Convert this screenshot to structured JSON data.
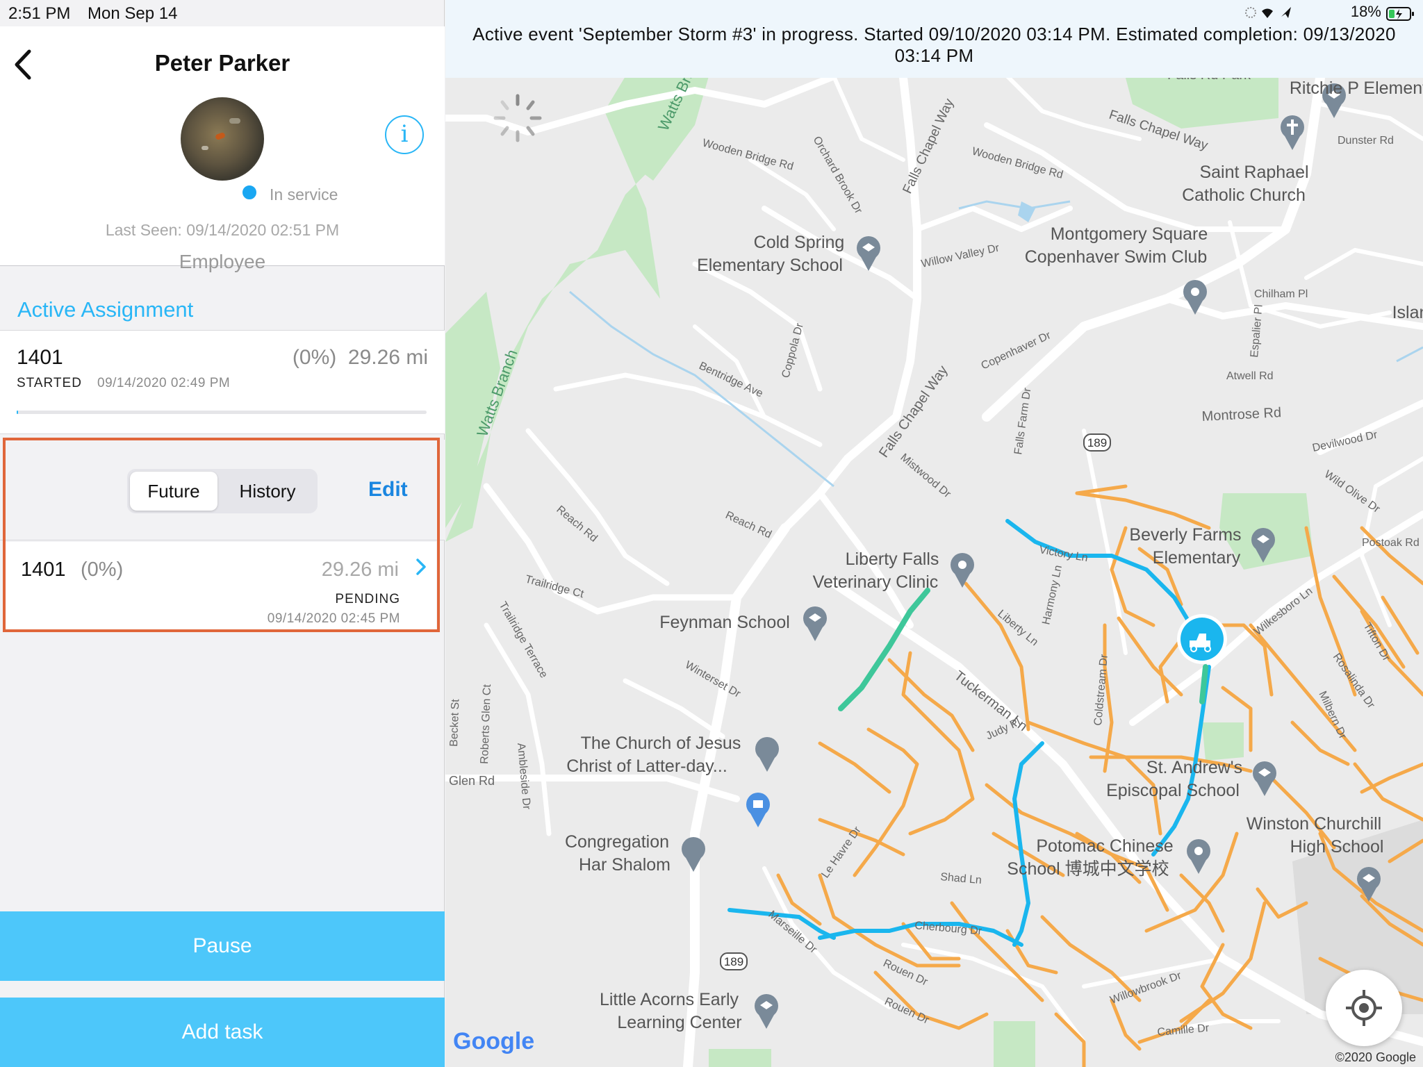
{
  "statusbar": {
    "time": "2:51 PM",
    "date": "Mon Sep 14",
    "battery": "18%"
  },
  "profile": {
    "name": "Peter  Parker",
    "status": "In service",
    "last_seen": "Last Seen: 09/14/2020 02:51 PM",
    "role": "Employee",
    "info_icon": "i"
  },
  "active_assignment": {
    "title": "Active Assignment",
    "id": "1401",
    "percent": "(0%)",
    "distance": "29.26 mi",
    "state": "STARTED",
    "time": "09/14/2020 02:49 PM",
    "progress_fraction": 0.004
  },
  "tasks": {
    "tabs": [
      "Future",
      "History"
    ],
    "active_tab": "Future",
    "edit_label": "Edit",
    "item": {
      "id": "1401",
      "percent": "(0%)",
      "distance": "29.26 mi",
      "state": "PENDING",
      "time": "09/14/2020 02:45 PM"
    }
  },
  "buttons": {
    "pause": "Pause",
    "add_task": "Add task"
  },
  "banner": {
    "text": "Active event 'September Storm #3' in progress. Started 09/10/2020 03:14 PM. Estimated completion: 09/13/2020 03:14 PM"
  },
  "map": {
    "copyright": "©2020 Google",
    "logo": "Google",
    "places": {
      "ritchie": "Ritchie P Element",
      "saint_raphael_1": "Saint Raphael",
      "saint_raphael_2": "Catholic Church",
      "cold_spring_1": "Cold Spring",
      "cold_spring_2": "Elementary School",
      "montgomery_1": "Montgomery Square",
      "montgomery_2": "Copenhaver Swim Club",
      "beverly_1": "Beverly Farms",
      "beverly_2": "Elementary",
      "liberty_1": "Liberty Falls",
      "liberty_2": "Veterinary Clinic",
      "feynman": "Feynman School",
      "church_1": "The Church of Jesus",
      "church_2": "Christ of Latter-day...",
      "st_andrews_1": "St. Andrew's",
      "st_andrews_2": "Episcopal School",
      "winston_1": "Winston Churchill",
      "winston_2": "High School",
      "congregation_1": "Congregation",
      "congregation_2": "Har Shalom",
      "potomac_1": "Potomac Chinese",
      "potomac_2": "School 博城中文学校",
      "little_acorns_1": "Little Acorns Early",
      "little_acorns_2": "Learning Center",
      "islan": "Islan"
    },
    "roads": {
      "falls_rd_park": "Falls Rd Park",
      "falls_chapel": "Falls Chapel Way",
      "wooden_bridge": "Wooden Bridge Rd",
      "orchard_brook": "Orchard Brook Dr",
      "watts_branch": "Watts Branch",
      "willow_valley": "Willow Valley Dr",
      "copenhaver": "Copenhaver Dr",
      "coppola": "Coppola Dr",
      "bentridge": "Bentridge Ave",
      "montrose": "Montrose Rd",
      "tuckerman": "Tuckerman Ln",
      "reach": "Reach Rd",
      "trailridge_ct": "Trailridge Ct",
      "trailridge_ter": "Trailridge Terrace",
      "winterset": "Winterset Dr",
      "glen": "Glen Rd",
      "victory": "Victory Ln",
      "harmony": "Harmony Ln",
      "liberty_ln": "Liberty Ln",
      "judy": "Judy Pl",
      "coldstream": "Coldstream Dr",
      "le_havre": "Le Havre Dr",
      "shad": "Shad Ln",
      "cherbourg": "Cherbourg Dr",
      "marseille": "Marseille Dr",
      "rouen": "Rouen Dr",
      "willowbrook": "Willowbrook Dr",
      "camille": "Camille Dr",
      "wilkesboro": "Wilkesboro Ln",
      "rosalinda": "Rosalinda Dr",
      "milbern": "Milbern Dr",
      "tifton": "Tifton Dr",
      "postoak": "Postoak Rd",
      "devilwood": "Devilwood Dr",
      "wild_olive": "Wild Olive Dr",
      "atwell": "Atwell Rd",
      "chilham": "Chilham Pl",
      "espalier": "Espalier Pl",
      "dunster": "Dunster Rd",
      "mistwood": "Mistwood Dr",
      "falls_farm": "Falls Farm Dr",
      "ambleside": "Ambleside Dr",
      "roberts_glen": "Roberts Glen Ct",
      "becket": "Becket St",
      "route_189": "189"
    }
  }
}
